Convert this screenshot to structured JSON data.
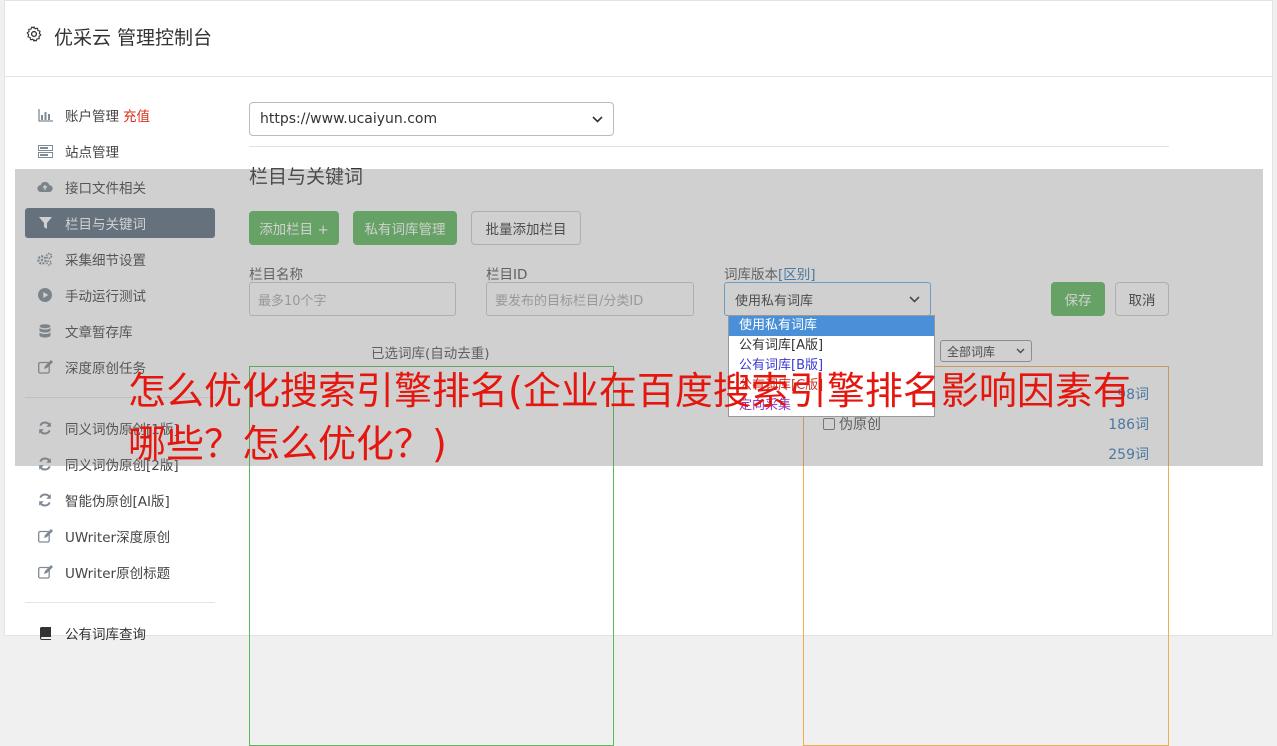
{
  "header": {
    "title": "优采云 管理控制台"
  },
  "sidebar": {
    "items": [
      {
        "label": "账户管理",
        "extra": "充值",
        "icon": "bar-chart-icon"
      },
      {
        "label": "站点管理",
        "icon": "server-icon"
      },
      {
        "label": "接口文件相关",
        "icon": "cloud-upload-icon"
      },
      {
        "label": "栏目与关键词",
        "icon": "filter-icon",
        "active": true
      },
      {
        "label": "采集细节设置",
        "icon": "gears-icon"
      },
      {
        "label": "手动运行测试",
        "icon": "play-circle-icon"
      },
      {
        "label": "文章暂存库",
        "icon": "database-icon"
      },
      {
        "label": "深度原创任务",
        "icon": "edit-icon"
      },
      {
        "label": "同义词伪原创[1版]",
        "icon": "refresh-icon"
      },
      {
        "label": "同义词伪原创[2版]",
        "icon": "refresh-icon"
      },
      {
        "label": "智能伪原创[AI版]",
        "icon": "refresh-icon"
      },
      {
        "label": "UWriter深度原创",
        "icon": "edit-icon"
      },
      {
        "label": "UWriter原创标题",
        "icon": "edit-icon"
      },
      {
        "label": "公有词库查询",
        "icon": "book-icon"
      }
    ]
  },
  "main": {
    "site_select_value": "https://www.ucaiyun.com",
    "section_title": "栏目与关键词",
    "buttons": {
      "add_column": "添加栏目 +",
      "private_lib": "私有词库管理",
      "batch_add": "批量添加栏目",
      "save": "保存",
      "cancel": "取消"
    },
    "form": {
      "column_name_label": "栏目名称",
      "column_name_placeholder": "最多10个字",
      "column_id_label": "栏目ID",
      "column_id_placeholder": "要发布的目标栏目/分类ID",
      "lib_version_label": "词库版本",
      "lib_version_link": "[区别]",
      "lib_version_value": "使用私有词库"
    },
    "dropdown_options": [
      {
        "label": "使用私有词库",
        "color": "#ffffff",
        "selected": true
      },
      {
        "label": "公有词库[A版]",
        "color": "#333333"
      },
      {
        "label": "公有词库[B版]",
        "color": "#3a3ad6"
      },
      {
        "label": "公有词库[C版]",
        "color": "#c0392b"
      },
      {
        "label": "定向采集",
        "color": "#8e3ac4"
      }
    ],
    "selected_lib_title": "已选词库(自动去重)",
    "all_lib_select": "全部词库",
    "lib_rows": [
      {
        "name": "",
        "count": "98词"
      },
      {
        "name": "伪原创",
        "count": "186词"
      },
      {
        "name": "",
        "count": "259词"
      }
    ]
  },
  "overlay_caption": "怎么优化搜索引擎排名(企业在百度搜索引擎排名影响因素有哪些？怎么优化？)"
}
